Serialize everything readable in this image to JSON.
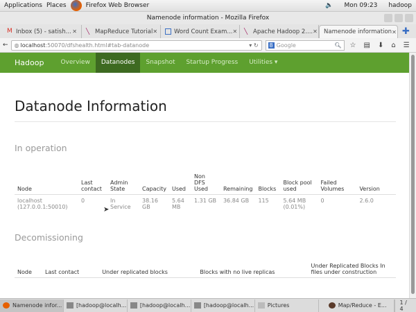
{
  "desktop": {
    "applications": "Applications",
    "places": "Places",
    "active_app": "Firefox Web Browser",
    "clock": "Mon 09:23",
    "user": "hadoop"
  },
  "window": {
    "title": "Namenode information - Mozilla Firefox"
  },
  "tabs": [
    {
      "label": "Inbox (5) - satish...",
      "icon": "gmail-icon",
      "color": "#d93025"
    },
    {
      "label": "MapReduce Tutorial",
      "icon": "feather-icon",
      "color": "#a0195d"
    },
    {
      "label": "Word Count Exam...",
      "icon": "page-icon",
      "color": "#3a6fc4"
    },
    {
      "label": "Apache Hadoop 2....",
      "icon": "feather-icon",
      "color": "#a0195d"
    },
    {
      "label": "Namenode information",
      "icon": "",
      "color": ""
    }
  ],
  "url": {
    "host": "localhost",
    "path": ":50070/dfshealth.html#tab-datanode"
  },
  "search": {
    "placeholder": "Google"
  },
  "hadoop_nav": {
    "brand": "Hadoop",
    "items": [
      "Overview",
      "Datanodes",
      "Snapshot",
      "Startup Progress",
      "Utilities ▾"
    ],
    "active": "Datanodes",
    "color": "#5ea02f"
  },
  "page": {
    "title": "Datanode Information",
    "in_operation": {
      "heading": "In operation",
      "columns": [
        "Node",
        "Last contact",
        "Admin State",
        "Capacity",
        "Used",
        "Non DFS Used",
        "Remaining",
        "Blocks",
        "Block pool used",
        "Failed Volumes",
        "Version"
      ],
      "rows": [
        [
          "localhost (127.0.0.1:50010)",
          "0",
          "In Service",
          "38.16 GB",
          "5.64 MB",
          "1.31 GB",
          "36.84 GB",
          "115",
          "5.64 MB (0.01%)",
          "0",
          "2.6.0"
        ]
      ]
    },
    "decommissioning": {
      "heading": "Decomissioning",
      "columns": [
        "Node",
        "Last contact",
        "Under replicated blocks",
        "Blocks with no live replicas",
        "Under Replicated Blocks In files under construction"
      ]
    }
  },
  "taskbar": {
    "items": [
      "Namenode infor...",
      "[hadoop@localh...",
      "[hadoop@localh...",
      "[hadoop@localh...",
      "Pictures",
      "Map/Reduce - E..."
    ],
    "workspace": "1 / 4"
  }
}
